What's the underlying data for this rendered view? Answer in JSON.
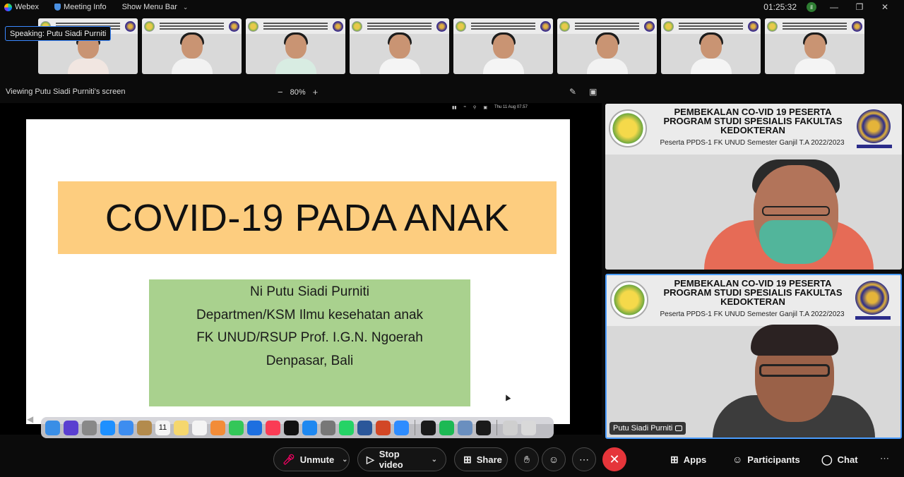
{
  "titlebar": {
    "app_name": "Webex",
    "meeting_info": "Meeting Info",
    "show_menu_bar": "Show Menu Bar",
    "clock": "01:25:32",
    "signal": "il"
  },
  "thumbnails": [
    {
      "shirt": "#f1e6e1"
    },
    {
      "shirt": "#f2f2f2"
    },
    {
      "shirt": "#d8ece2"
    },
    {
      "shirt": "#f4f4f4"
    },
    {
      "shirt": "#f4f4f4"
    },
    {
      "shirt": "#f2f2f2"
    },
    {
      "shirt": "#f4f4f4"
    },
    {
      "shirt": "#f4f4f4"
    }
  ],
  "speaking": {
    "label": "Speaking: Putu Siadi Purniti"
  },
  "viewbar": {
    "viewing": "Viewing Putu Siadi Purniti's screen",
    "zoom": "80%",
    "zoom_out": "−",
    "zoom_in": "+"
  },
  "mac_menubar": {
    "datetime": "Thu 11 Aug  07.57"
  },
  "slide": {
    "title": "COVID-19 PADA ANAK",
    "lines": [
      "Ni Putu Siadi Purniti",
      "Departmen/KSM Ilmu kesehatan anak",
      "FK UNUD/RSUP Prof. I.G.N. Ngoerah",
      "Denpasar, Bali"
    ]
  },
  "dock": {
    "calendar_day": "11",
    "icons": [
      {
        "name": "finder-icon",
        "color": "#3a8ee6"
      },
      {
        "name": "siri-icon",
        "color": "#5a3fd0"
      },
      {
        "name": "launchpad-icon",
        "color": "#888"
      },
      {
        "name": "safari-icon",
        "color": "#1e90ff"
      },
      {
        "name": "mail-icon",
        "color": "#3d8df0"
      },
      {
        "name": "notes-folder-icon",
        "color": "#b38b4d"
      },
      {
        "name": "calendar-icon",
        "color": "#f4f4f4"
      },
      {
        "name": "notes-icon",
        "color": "#f5d76e"
      },
      {
        "name": "reminders-icon",
        "color": "#f4f4f4"
      },
      {
        "name": "photos-icon",
        "color": "#f28c38"
      },
      {
        "name": "facetime-icon",
        "color": "#34c759"
      },
      {
        "name": "keynote-icon",
        "color": "#1d6fe0"
      },
      {
        "name": "music-icon",
        "color": "#fa3c55"
      },
      {
        "name": "appletv-icon",
        "color": "#111"
      },
      {
        "name": "appstore-icon",
        "color": "#1e88f0"
      },
      {
        "name": "settings-icon",
        "color": "#777"
      },
      {
        "name": "whatsapp-icon",
        "color": "#25d366"
      },
      {
        "name": "word-icon",
        "color": "#2b579a"
      },
      {
        "name": "powerpoint-icon",
        "color": "#d24726"
      },
      {
        "name": "zoom-icon",
        "color": "#2d8cff"
      },
      {
        "name": "webex-icon",
        "color": "#1a1a1a"
      },
      {
        "name": "spotify-icon",
        "color": "#1db954"
      },
      {
        "name": "preview-icon",
        "color": "#6a8fbf"
      },
      {
        "name": "webex-meetings-icon",
        "color": "#1a1a1a"
      },
      {
        "name": "downloads-icon",
        "color": "#cfcfcf"
      },
      {
        "name": "trash-icon",
        "color": "#d9d9d9"
      }
    ]
  },
  "tiles": {
    "banner_line1": "PEMBEKALAN CO-VID 19 PESERTA",
    "banner_line2": "PROGRAM STUDI SPESIALIS FAKULTAS",
    "banner_line3": "KEDOKTERAN",
    "tile1_sub": "Peserta PPDS-1 FK UNUD Semester Ganjil T.A 2022/2023",
    "tile2_sub": "Peserta PPDS-1 FK UNUD Semester Ganjil T.A 2022/2023",
    "tile2_name": "Putu Siadi Purniti"
  },
  "controls": {
    "unmute": "Unmute",
    "stop_video": "Stop video",
    "share": "Share",
    "apps": "Apps",
    "participants": "Participants",
    "chat": "Chat"
  }
}
